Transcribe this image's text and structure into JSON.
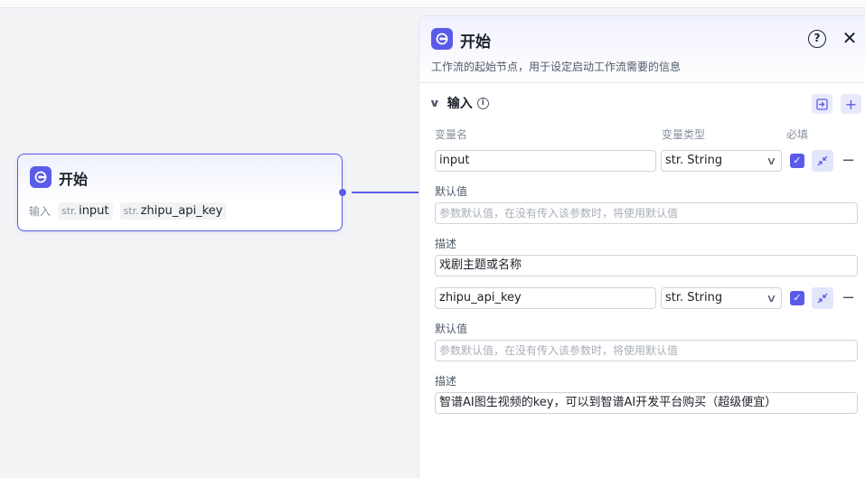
{
  "node": {
    "title": "开始",
    "inputs_label": "输入",
    "inputs": [
      {
        "type": "str.",
        "name": "input"
      },
      {
        "type": "str.",
        "name": "zhipu_api_key"
      }
    ]
  },
  "panel": {
    "title": "开始",
    "description": "工作流的起始节点，用于设定启动工作流需要的信息",
    "help_icon": "?",
    "close_icon": "✕",
    "section_title": "输入",
    "columns": {
      "name": "变量名",
      "type": "变量类型",
      "required": "必填"
    },
    "variables": [
      {
        "name": "input",
        "type": "str. String",
        "required": true,
        "default_label": "默认值",
        "default_placeholder": "参数默认值，在没有传入该参数时，将使用默认值",
        "desc_label": "描述",
        "desc": "戏剧主题或名称"
      },
      {
        "name": "zhipu_api_key",
        "type": "str. String",
        "required": true,
        "default_label": "默认值",
        "default_placeholder": "参数默认值，在没有传入该参数时，将使用默认值",
        "desc_label": "描述",
        "desc": "智谱AI图生视频的key，可以到智谱AI开发平台购买（超级便宜）"
      }
    ]
  },
  "icons": {
    "start": "start-icon",
    "help": "help-icon",
    "close": "close-icon",
    "chevron": "chevron-down-icon",
    "info": "info-icon",
    "import": "import-icon",
    "add": "plus-icon",
    "collapse": "collapse-icon",
    "remove": "minus-icon"
  },
  "colors": {
    "accent": "#5b5bea",
    "canvas": "#f2f3f5"
  }
}
